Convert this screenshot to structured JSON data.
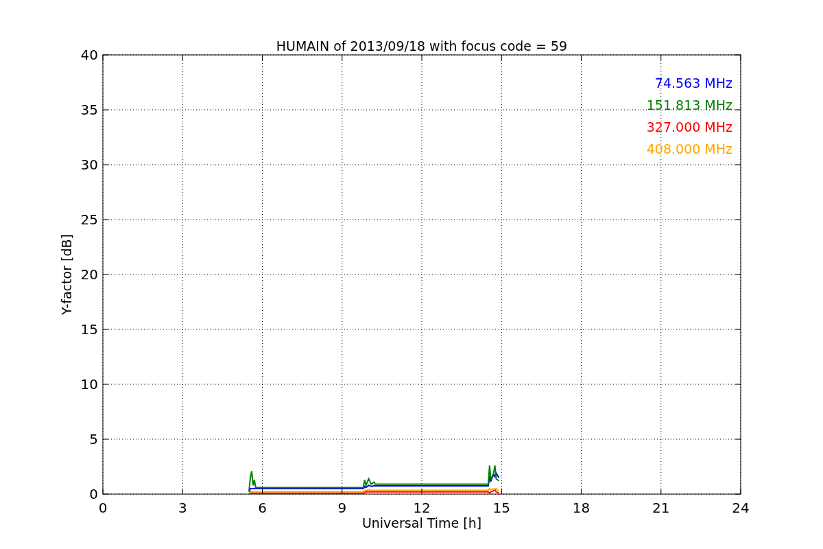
{
  "chart_data": {
    "type": "line",
    "title": "HUMAIN of 2013/09/18 with focus code = 59",
    "xlabel": "Universal Time [h]",
    "ylabel": "Y-factor [dB]",
    "x": [
      5.5,
      5.55,
      5.6,
      5.65,
      5.7,
      5.75,
      5.8,
      9.8,
      9.85,
      9.9,
      10,
      10.1,
      10.2,
      10.25,
      14.5,
      14.55,
      14.6,
      14.7,
      14.75,
      14.8,
      14.9
    ],
    "series": [
      {
        "name": "74.563 MHz",
        "color": "#0000ff",
        "values": [
          0.2,
          0.5,
          0.5,
          0.5,
          0.5,
          0.5,
          0.5,
          0.5,
          0.7,
          0.6,
          0.8,
          0.7,
          0.75,
          0.75,
          0.75,
          1.5,
          1.2,
          1.8,
          1.6,
          1.9,
          1.5
        ]
      },
      {
        "name": "151.813 MHz",
        "color": "#008000",
        "values": [
          0.3,
          1.5,
          2.1,
          0.8,
          1.3,
          0.6,
          0.6,
          0.6,
          1.3,
          0.8,
          1.4,
          0.9,
          1.1,
          0.9,
          0.9,
          2.6,
          1.3,
          1.9,
          2.6,
          1.4,
          1.2
        ]
      },
      {
        "name": "327.000 MHz",
        "color": "#ff0000",
        "values": [
          0.05,
          0.1,
          0.1,
          0.1,
          0.1,
          0.1,
          0.1,
          0.1,
          0.15,
          0.2,
          0.2,
          0.2,
          0.2,
          0.2,
          0.2,
          0.1,
          0.2,
          0.3,
          0.4,
          0.2,
          0.1
        ]
      },
      {
        "name": "408.000 MHz",
        "color": "#ffa500",
        "values": [
          0.1,
          0.2,
          0.25,
          0.2,
          0.2,
          0.2,
          0.2,
          0.2,
          0.35,
          0.3,
          0.4,
          0.35,
          0.35,
          0.35,
          0.35,
          0.5,
          0.4,
          0.5,
          0.45,
          0.5,
          0.3
        ]
      }
    ],
    "xlim": [
      0,
      24
    ],
    "ylim": [
      0,
      40
    ],
    "xticks": [
      0,
      3,
      6,
      9,
      12,
      15,
      18,
      21,
      24
    ],
    "yticks": [
      0,
      5,
      10,
      15,
      20,
      25,
      30,
      35,
      40
    ],
    "grid": true
  }
}
